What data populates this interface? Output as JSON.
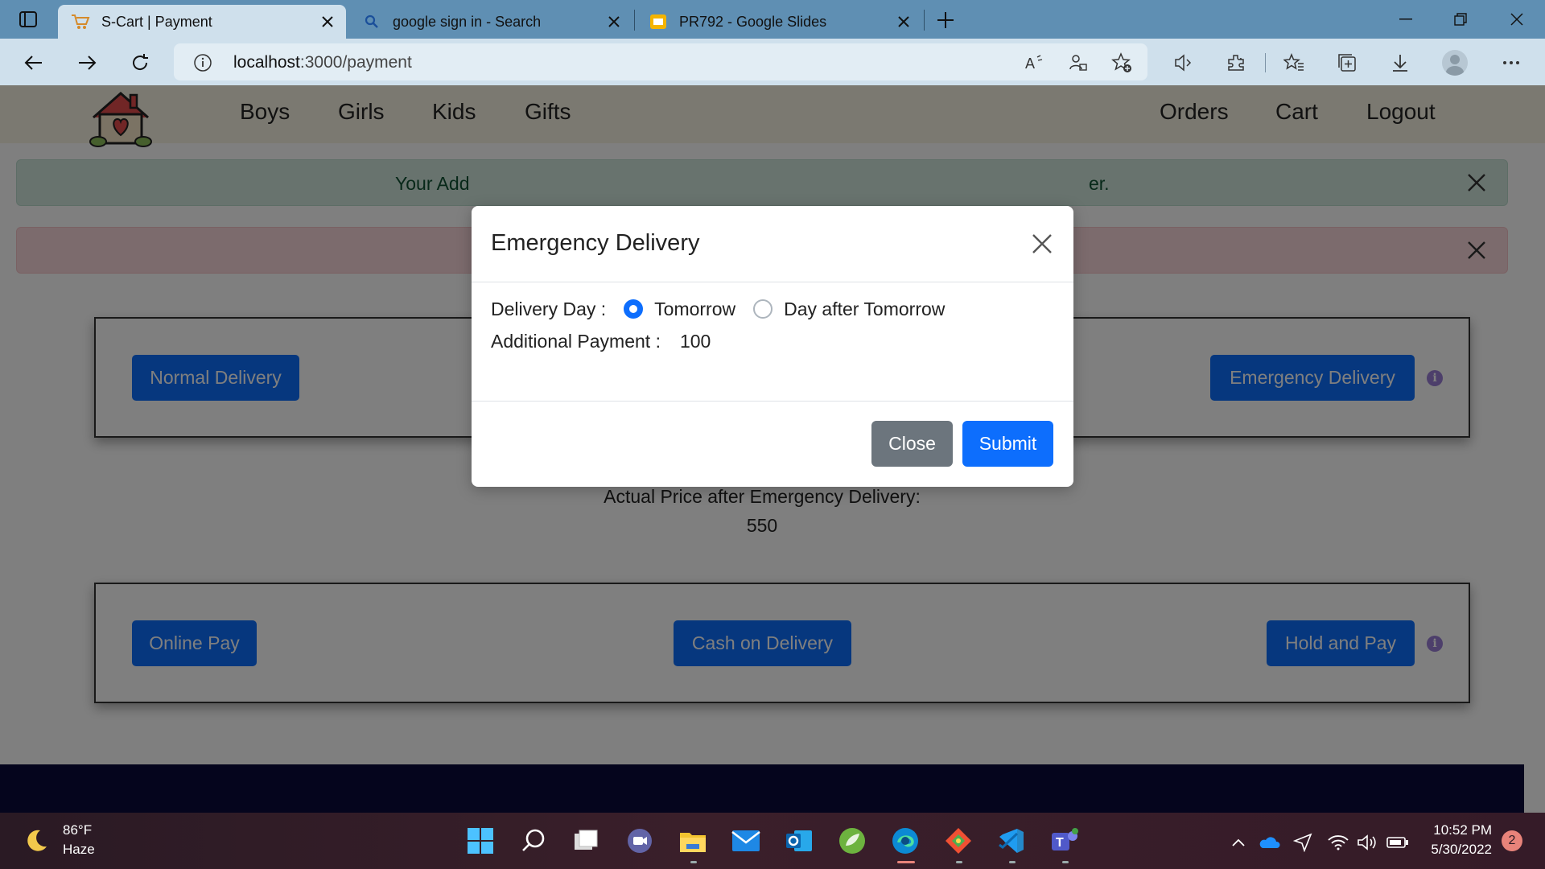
{
  "browser": {
    "tabs": [
      {
        "title": "S-Cart | Payment",
        "active": true
      },
      {
        "title": "google sign in - Search",
        "active": false
      },
      {
        "title": "PR792 - Google Slides",
        "active": false
      }
    ],
    "address": {
      "host": "localhost",
      "path": ":3000/payment"
    }
  },
  "site": {
    "nav_left": [
      "Boys",
      "Girls",
      "Kids",
      "Gifts"
    ],
    "nav_right": [
      "Orders",
      "Cart",
      "Logout"
    ]
  },
  "alerts": {
    "success_left": "Your Add",
    "success_right": "er."
  },
  "delivery": {
    "normal_label": "Normal Delivery",
    "emergency_label": "Emergency Delivery",
    "price_label": "Actual Price after Emergency Delivery:",
    "price_value": "550"
  },
  "payment": {
    "online_label": "Online Pay",
    "cod_label": "Cash on Delivery",
    "hold_label": "Hold and Pay"
  },
  "modal": {
    "title": "Emergency Delivery",
    "delivery_day_label": "Delivery Day :",
    "option_tomorrow": "Tomorrow",
    "option_day_after": "Day after Tomorrow",
    "selected": "Tomorrow",
    "additional_payment_label": "Additional Payment :",
    "additional_payment_value": "100",
    "close_label": "Close",
    "submit_label": "Submit"
  },
  "taskbar": {
    "weather_temp": "86°F",
    "weather_desc": "Haze",
    "time": "10:52 PM",
    "date": "5/30/2022",
    "notifications": "2"
  },
  "colors": {
    "primary": "#0d6efd",
    "secondary": "#6c757d",
    "browser_chrome": "#5f8fb3"
  }
}
